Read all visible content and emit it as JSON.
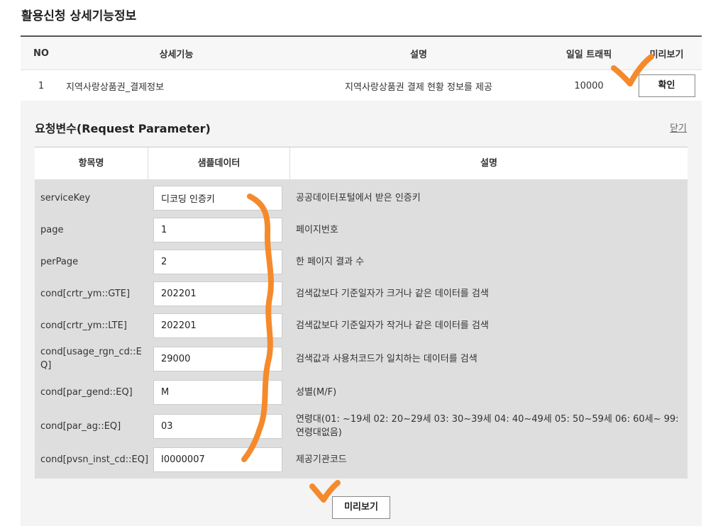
{
  "page": {
    "title": "활용신청 상세기능정보"
  },
  "top_table": {
    "headers": {
      "no": "NO",
      "function": "상세기능",
      "description": "설명",
      "traffic": "일일 트래픽",
      "preview": "미리보기"
    },
    "row": {
      "no": "1",
      "function": "지역사랑상품권_결제정보",
      "description": "지역사랑상품권 결제 현황 정보를 제공",
      "traffic": "10000",
      "button": "확인"
    }
  },
  "request": {
    "title": "요청변수(Request Parameter)",
    "close_label": "닫기",
    "headers": {
      "name": "항목명",
      "sample": "샘플데이터",
      "description": "설명"
    },
    "rows": [
      {
        "name": "serviceKey",
        "value": "디코딩 인증키",
        "description": "공공데이터포털에서 받은 인증키"
      },
      {
        "name": "page",
        "value": "1",
        "description": "페이지번호"
      },
      {
        "name": "perPage",
        "value": "2",
        "description": "한 페이지 결과 수"
      },
      {
        "name": "cond[crtr_ym::GTE]",
        "value": "202201",
        "description": "검색값보다 기준일자가 크거나 같은 데이터를 검색"
      },
      {
        "name": "cond[crtr_ym::LTE]",
        "value": "202201",
        "description": "검색값보다 기준일자가 작거나 같은 데이터를 검색"
      },
      {
        "name": "cond[usage_rgn_cd::EQ]",
        "value": "29000",
        "description": "검색값과 사용처코드가 일치하는 데이터를 검색"
      },
      {
        "name": "cond[par_gend::EQ]",
        "value": "M",
        "description": "성별(M/F)"
      },
      {
        "name": "cond[par_ag::EQ]",
        "value": "03",
        "description": "연령대(01: ~19세 02: 20~29세 03: 30~39세 04: 40~49세 05: 50~59세 06: 60세~ 99: 연령대없음)"
      },
      {
        "name": "cond[pvsn_inst_cd::EQ]",
        "value": "I0000007",
        "description": "제공기관코드"
      }
    ],
    "preview_button": "미리보기"
  },
  "colors": {
    "annotation": "#f58a2c",
    "table_body_bg": "#dedede",
    "panel_bg": "#f4f4f4"
  }
}
